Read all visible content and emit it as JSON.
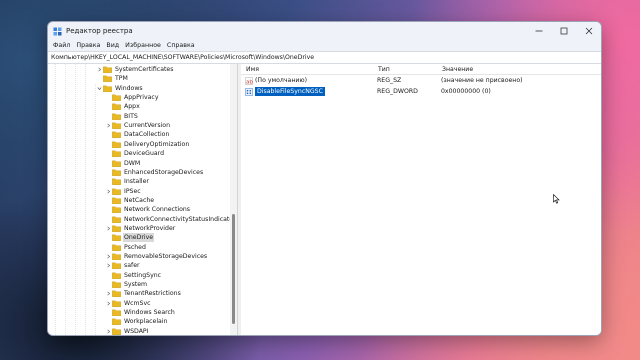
{
  "window": {
    "title": "Редактор реестра"
  },
  "menu": [
    "Файл",
    "Правка",
    "Вид",
    "Избранное",
    "Справка"
  ],
  "address": "Компьютер\\HKEY_LOCAL_MACHINE\\SOFTWARE\\Policies\\Microsoft\\Windows\\OneDrive",
  "tree": {
    "items": [
      {
        "label": "SystemCertificates",
        "level": 0,
        "chevron": "right"
      },
      {
        "label": "TPM",
        "level": 0,
        "chevron": "none"
      },
      {
        "label": "Windows",
        "level": 0,
        "chevron": "down"
      },
      {
        "label": "AppPrivacy",
        "level": 1,
        "chevron": "none"
      },
      {
        "label": "Appx",
        "level": 1,
        "chevron": "none"
      },
      {
        "label": "BITS",
        "level": 1,
        "chevron": "none"
      },
      {
        "label": "CurrentVersion",
        "level": 1,
        "chevron": "right"
      },
      {
        "label": "DataCollection",
        "level": 1,
        "chevron": "none"
      },
      {
        "label": "DeliveryOptimization",
        "level": 1,
        "chevron": "none"
      },
      {
        "label": "DeviceGuard",
        "level": 1,
        "chevron": "none"
      },
      {
        "label": "DWM",
        "level": 1,
        "chevron": "none"
      },
      {
        "label": "EnhancedStorageDevices",
        "level": 1,
        "chevron": "none"
      },
      {
        "label": "Installer",
        "level": 1,
        "chevron": "none"
      },
      {
        "label": "IPSec",
        "level": 1,
        "chevron": "right"
      },
      {
        "label": "NetCache",
        "level": 1,
        "chevron": "none"
      },
      {
        "label": "Network Connections",
        "level": 1,
        "chevron": "none"
      },
      {
        "label": "NetworkConnectivityStatusIndicator",
        "level": 1,
        "chevron": "none"
      },
      {
        "label": "NetworkProvider",
        "level": 1,
        "chevron": "right"
      },
      {
        "label": "OneDrive",
        "level": 1,
        "chevron": "none",
        "selected": true
      },
      {
        "label": "Psched",
        "level": 1,
        "chevron": "none"
      },
      {
        "label": "RemovableStorageDevices",
        "level": 1,
        "chevron": "right"
      },
      {
        "label": "safer",
        "level": 1,
        "chevron": "right"
      },
      {
        "label": "SettingSync",
        "level": 1,
        "chevron": "none"
      },
      {
        "label": "System",
        "level": 1,
        "chevron": "none"
      },
      {
        "label": "TenantRestrictions",
        "level": 1,
        "chevron": "right"
      },
      {
        "label": "WcmSvc",
        "level": 1,
        "chevron": "right"
      },
      {
        "label": "Windows Search",
        "level": 1,
        "chevron": "none"
      },
      {
        "label": "Workplacelain",
        "level": 1,
        "chevron": "none"
      },
      {
        "label": "WSDAPI",
        "level": 1,
        "chevron": "right"
      }
    ]
  },
  "values_pane": {
    "headers": {
      "name": "Имя",
      "type": "Тип",
      "data": "Значение"
    },
    "rows": [
      {
        "name": "(По умолчанию)",
        "type": "REG_SZ",
        "data": "(значение не присвоено)",
        "icon": "string-value-icon",
        "selected": false
      },
      {
        "name": "DisableFileSyncNGSC",
        "type": "REG_DWORD",
        "data": "0x00000000 (0)",
        "icon": "dword-value-icon",
        "selected": true
      }
    ]
  },
  "colors": {
    "folder": "#e8b923",
    "selection": "#0060c0",
    "tree_selection": "#d9d9d9"
  }
}
